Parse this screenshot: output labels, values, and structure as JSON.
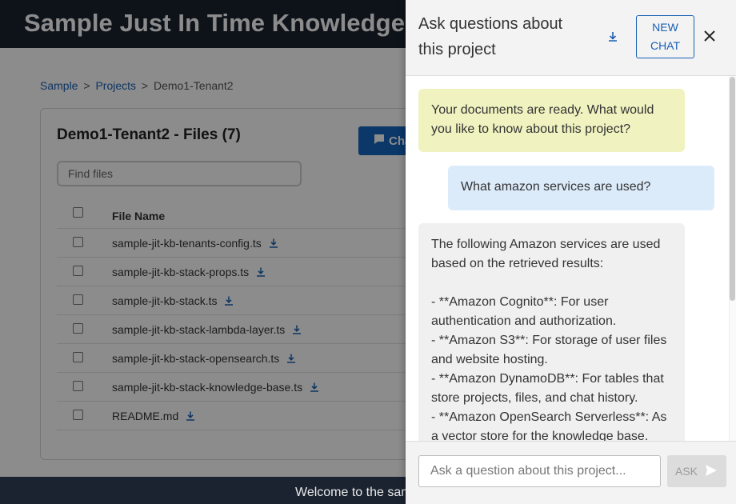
{
  "header": {
    "title": "Sample Just In Time Knowledge Base"
  },
  "breadcrumb": {
    "items": [
      "Sample",
      "Projects",
      "Demo1-Tenant2"
    ],
    "separator": ">"
  },
  "files": {
    "title": "Demo1-Tenant2 - Files (7)",
    "chat_button_label": "Chat",
    "search_placeholder": "Find files",
    "column_header": "File Name",
    "rows": [
      "sample-jit-kb-tenants-config.ts",
      "sample-jit-kb-stack-props.ts",
      "sample-jit-kb-stack.ts",
      "sample-jit-kb-stack-lambda-layer.ts",
      "sample-jit-kb-stack-opensearch.ts",
      "sample-jit-kb-stack-knowledge-base.ts",
      "README.md"
    ]
  },
  "footer": {
    "text": "Welcome to the sample"
  },
  "chat": {
    "title": "Ask questions about this project",
    "new_chat_label_line1": "NEW",
    "new_chat_label_line2": "CHAT",
    "messages": [
      {
        "role": "assistant",
        "text": "Your documents are ready. What would you like to know about this project?"
      },
      {
        "role": "user",
        "text": "What amazon services are used?"
      },
      {
        "role": "assistant",
        "text": "The following Amazon services are used based on the retrieved results:\n\n- **Amazon Cognito**: For user authentication and authorization.\n- **Amazon S3**: For storage of user files and website hosting.\n- **Amazon DynamoDB**: For tables that store projects, files, and chat history.\n- **Amazon OpenSearch Serverless**: As a vector store for the knowledge base."
      }
    ],
    "input_placeholder": "Ask a question about this project...",
    "ask_label": "ASK"
  },
  "colors": {
    "header_bg": "#1b2330",
    "accent": "#1a5fb4",
    "assistant_bubble": "#f0f2c0",
    "user_bubble": "#dcebfa",
    "response_bubble": "#f0f0f0"
  },
  "icons": [
    "download-icon",
    "chat-bubble-icon",
    "close-icon",
    "send-icon"
  ]
}
